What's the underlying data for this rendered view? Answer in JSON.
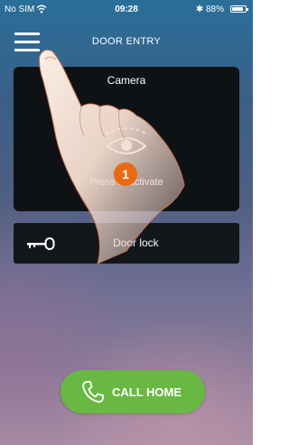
{
  "status_bar": {
    "carrier": "No SIM",
    "time": "09:28",
    "battery": "✱ 88%",
    "battery_level": 0.88
  },
  "header": {
    "title": "DOOR ENTRY",
    "menu_icon": "hamburger-menu-icon"
  },
  "camera": {
    "label": "Camera",
    "hint": "Press to activate",
    "icon": "eye-icon"
  },
  "door_lock": {
    "label": "Door lock",
    "icon": "key-icon"
  },
  "call_button": {
    "label": "CALL HOME",
    "icon": "phone-icon"
  },
  "annotation": {
    "step": "1"
  },
  "colors": {
    "accent_green": "#69b843",
    "step_orange": "#e86a14",
    "panel_dark": "#0f1214"
  }
}
